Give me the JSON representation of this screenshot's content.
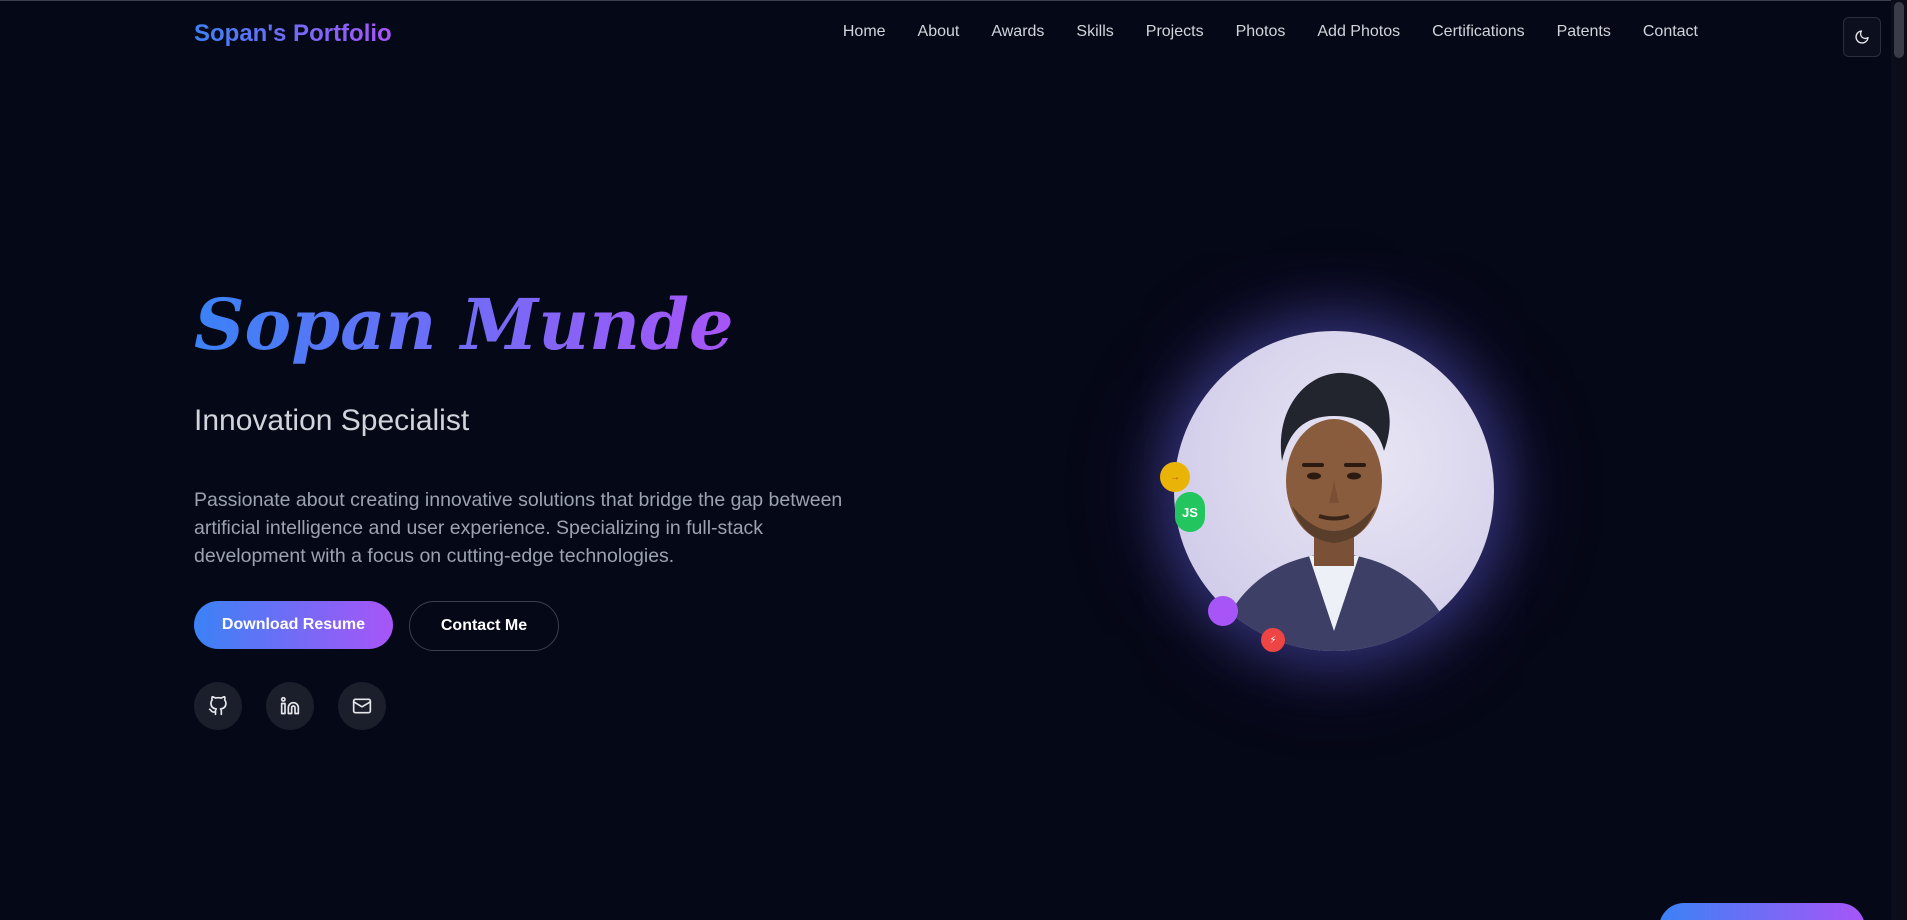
{
  "nav": {
    "logo": "Sopan's Portfolio",
    "links": [
      "Home",
      "About",
      "Awards",
      "Skills",
      "Projects",
      "Photos",
      "Add Photos",
      "Certifications",
      "Patents",
      "Contact"
    ],
    "theme_toggle_icon": "moon-icon"
  },
  "hero": {
    "name": "Sopan Munde",
    "role": "Innovation Specialist",
    "description": "Passionate about creating innovative solutions that bridge the gap between artificial intelligence and user experience. Specializing in full-stack development with a focus on cutting-edge technologies.",
    "primary_button": "Download Resume",
    "secondary_button": "Contact Me",
    "socials": [
      "github-icon",
      "linkedin-icon",
      "mail-icon"
    ]
  },
  "portrait": {
    "badges": [
      {
        "label": "→",
        "color": "#eab308"
      },
      {
        "label": "JS",
        "color": "#22c55e"
      },
      {
        "label": "",
        "color": "#a855f7"
      },
      {
        "label": "⚡",
        "color": "#ef4444"
      }
    ]
  },
  "colors": {
    "background": "#050816",
    "accent_start": "#3b82f6",
    "accent_end": "#a855f7"
  }
}
